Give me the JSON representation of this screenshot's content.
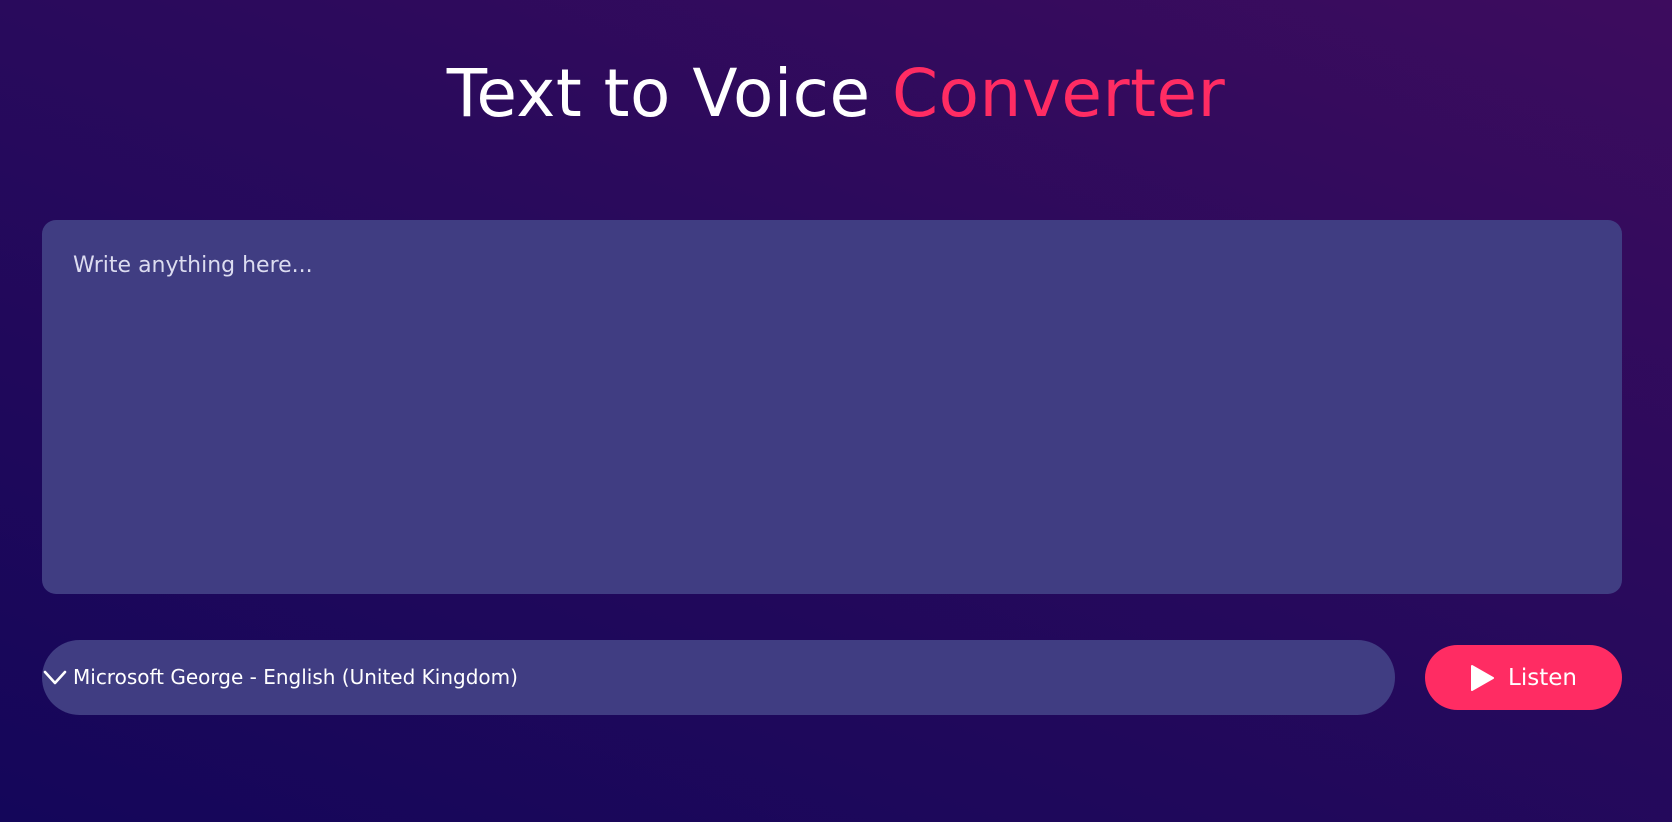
{
  "header": {
    "title_main": "Text to Voice",
    "title_accent": "Converter"
  },
  "editor": {
    "placeholder": "Write anything here...",
    "value": ""
  },
  "voice_select": {
    "selected": "Microsoft George - English (United Kingdom)",
    "icon": "chevron-down-icon"
  },
  "actions": {
    "listen_label": "Listen",
    "listen_icon": "play-icon"
  },
  "colors": {
    "accent": "#ff2c63",
    "panel": "#403d82",
    "background_top": "#3d0c5e",
    "background_bottom": "#14065a"
  }
}
